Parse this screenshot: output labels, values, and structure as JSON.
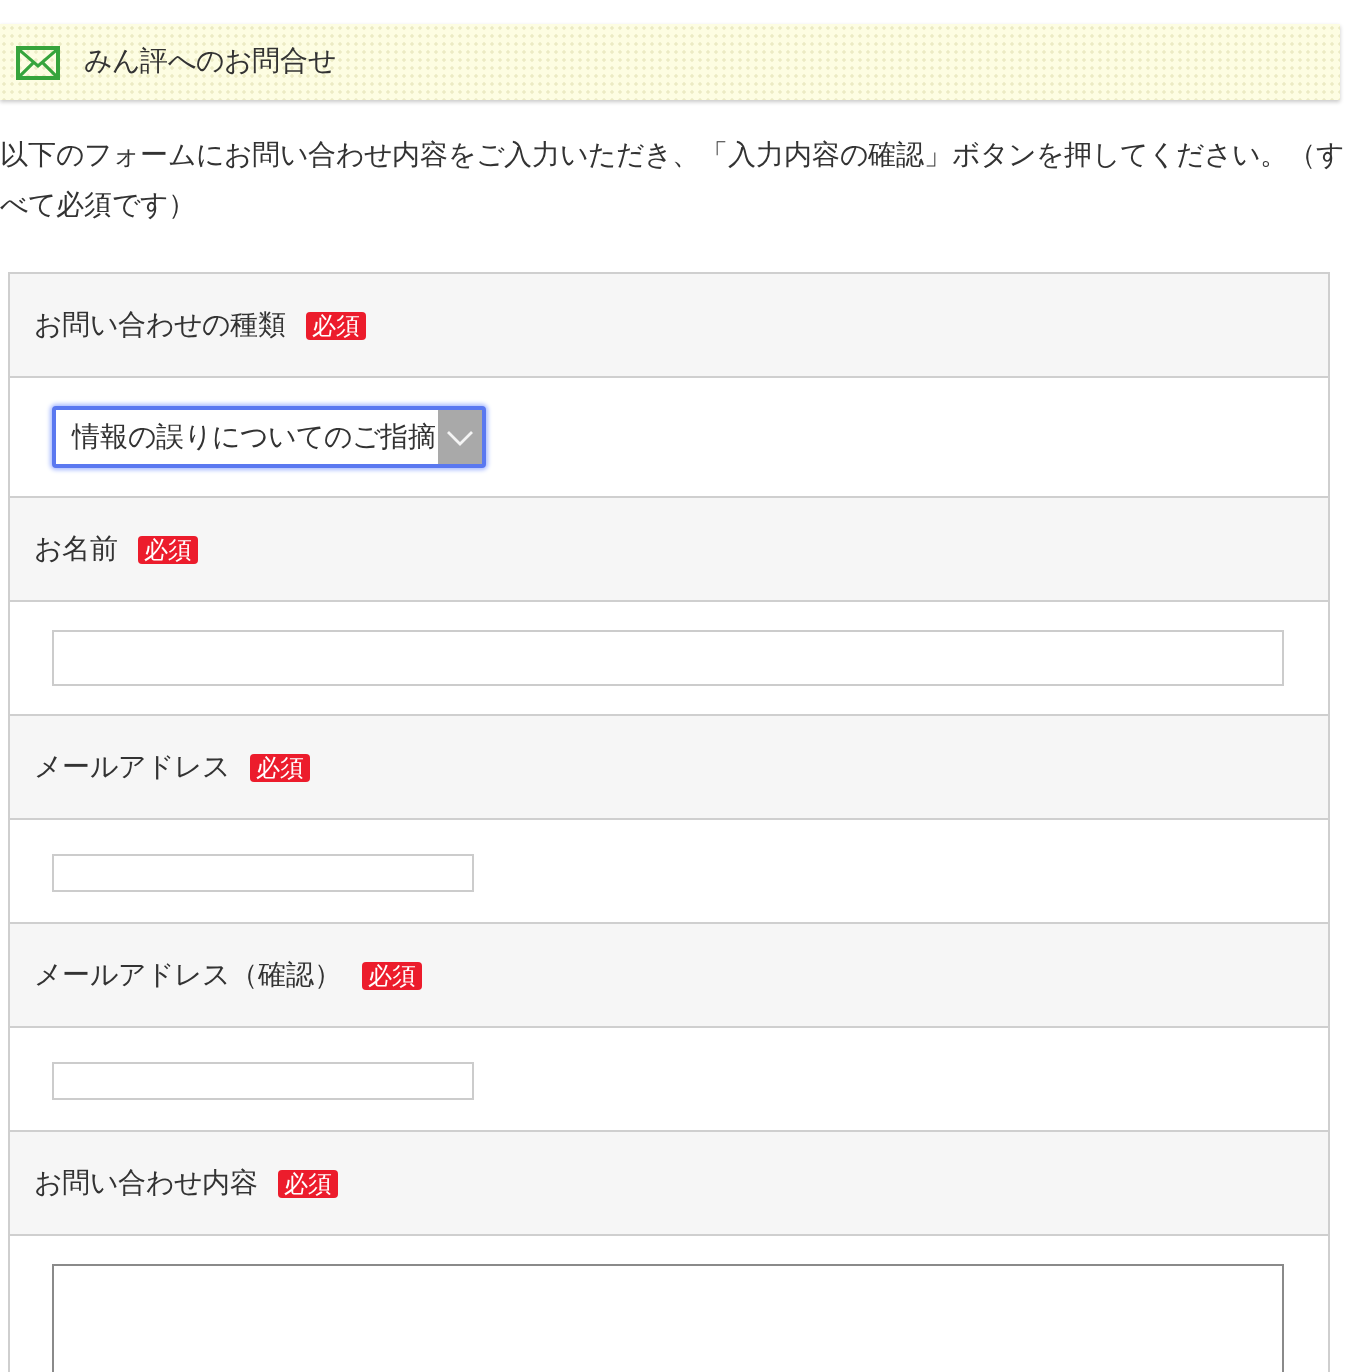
{
  "header": {
    "title": "みん評へのお問合せ"
  },
  "intro": "以下のフォームにお問い合わせ内容をご入力いただき、「入力内容の確認」ボタンを押してください。（すべて必須です）",
  "fields": [
    {
      "label": "お問い合わせの種類",
      "badge": "必須",
      "kind": "select",
      "value": "情報の誤りについてのご指摘",
      "focused": true
    },
    {
      "label": "お名前",
      "badge": "必須",
      "kind": "text",
      "focused": false
    },
    {
      "label": "メールアドレス",
      "badge": "必須",
      "kind": "email",
      "focused": false
    },
    {
      "label": "メールアドレス（確認）",
      "badge": "必須",
      "kind": "email",
      "focused": false
    },
    {
      "label": "お問い合わせ内容",
      "badge": "必須",
      "kind": "textarea",
      "focused": false
    }
  ]
}
